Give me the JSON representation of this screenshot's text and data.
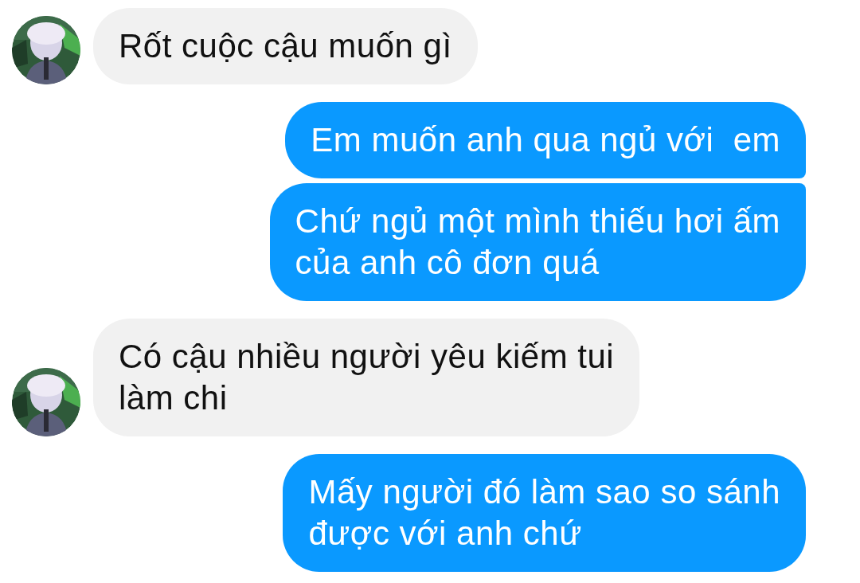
{
  "messages": [
    {
      "kind": "received",
      "text": "Rốt cuộc cậu muốn gì"
    },
    {
      "kind": "sent",
      "text": "Em muốn anh qua ngủ với  em"
    },
    {
      "kind": "sent",
      "text": "Chứ ngủ một mình thiếu hơi ấm\ncủa anh cô đơn quá"
    },
    {
      "kind": "received",
      "text": "Có cậu nhiều người yêu kiếm tui\nlàm chi"
    },
    {
      "kind": "sent",
      "text": "Mấy người đó làm sao so sánh\nđược với anh chứ"
    }
  ]
}
